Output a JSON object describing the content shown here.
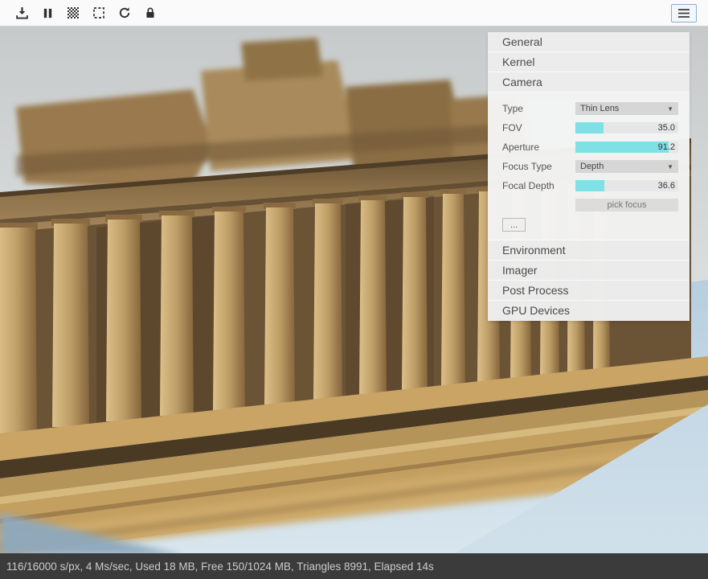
{
  "toolbar": {
    "icons": [
      {
        "name": "download-icon"
      },
      {
        "name": "pause-icon"
      },
      {
        "name": "dither-grid-icon"
      },
      {
        "name": "selection-region-icon"
      },
      {
        "name": "restart-render-icon"
      },
      {
        "name": "lock-icon"
      },
      {
        "name": "menu-icon"
      }
    ],
    "accent_border": "#8ab0d0"
  },
  "panel": {
    "sections": [
      {
        "label": "General"
      },
      {
        "label": "Kernel"
      },
      {
        "label": "Camera"
      },
      {
        "label": "Environment"
      },
      {
        "label": "Imager"
      },
      {
        "label": "Post Process"
      },
      {
        "label": "GPU Devices"
      }
    ],
    "camera": {
      "rows": [
        {
          "label": "Type",
          "control": "select",
          "value": "Thin Lens"
        },
        {
          "label": "FOV",
          "control": "slider",
          "value": "35.0"
        },
        {
          "label": "Aperture",
          "control": "slider",
          "value": "91.2"
        },
        {
          "label": "Focus Type",
          "control": "select",
          "value": "Depth"
        },
        {
          "label": "Focal Depth",
          "control": "slider",
          "value": "36.6"
        }
      ],
      "pick_focus": "pick focus",
      "more": "..."
    },
    "slider_fill_color": "#7fe0e6"
  },
  "status_bar": {
    "text": "116/16000 s/px, 4 Ms/sec, Used 18 MB, Free 150/1024 MB, Triangles 8991, Elapsed 14s"
  }
}
